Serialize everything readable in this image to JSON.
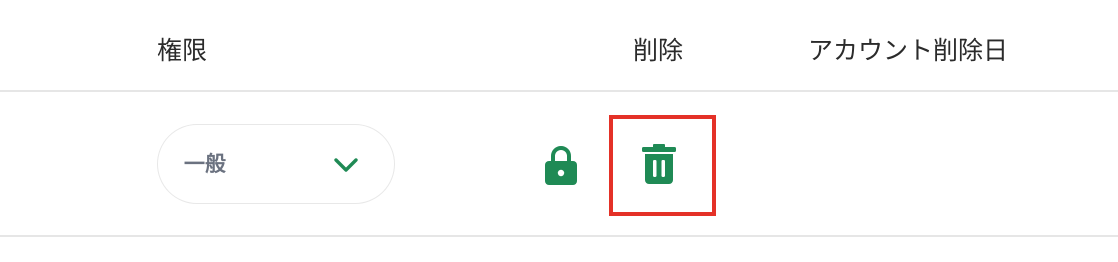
{
  "table": {
    "headers": {
      "permission": "権限",
      "delete": "削除",
      "account_deleted_date": "アカウント削除日"
    },
    "rows": [
      {
        "permission_value": "一般",
        "locked": true,
        "account_deleted_date": ""
      }
    ]
  },
  "icons": {
    "chevron": "chevron-down-icon",
    "lock": "lock-icon",
    "trash": "trash-icon"
  },
  "colors": {
    "accent_green": "#1f8a55",
    "highlight_red": "#e43127",
    "divider": "#e6e6e6"
  }
}
